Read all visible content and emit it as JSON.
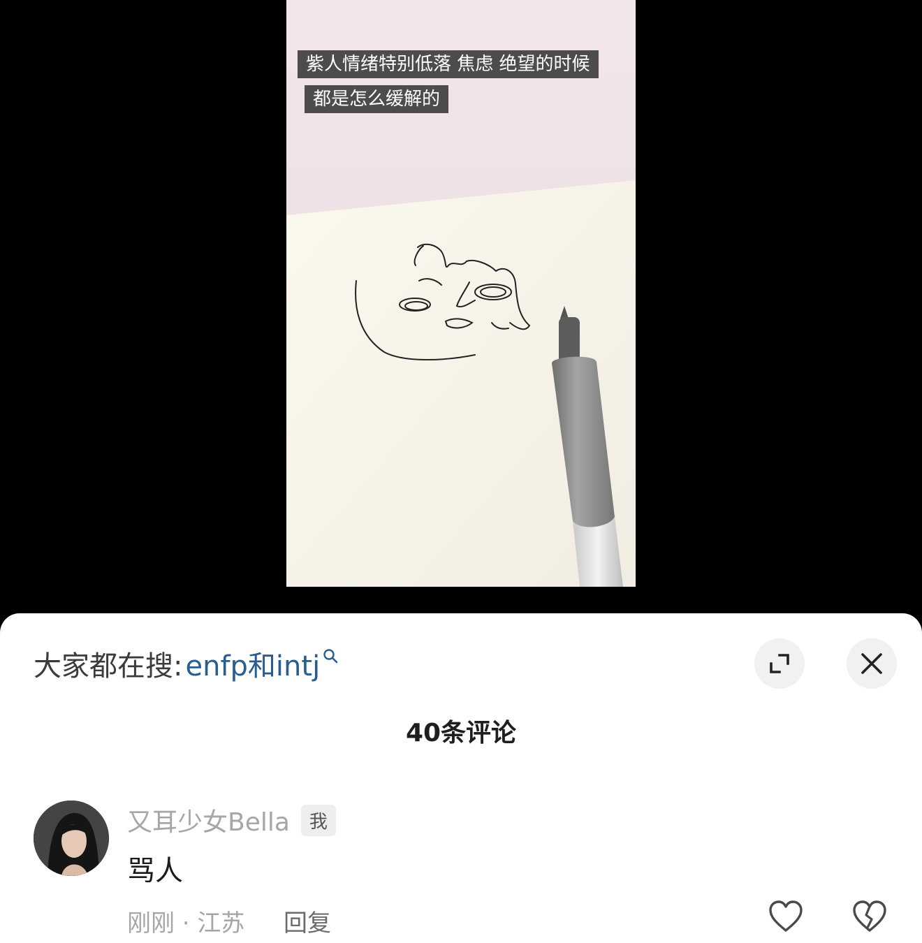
{
  "video": {
    "caption_line1": "紫人情绪特别低落 焦虑 绝望的时候",
    "caption_line2": "都是怎么缓解的"
  },
  "hot_search": {
    "prefix": "大家都在搜:",
    "keyword": "enfp和intj",
    "icon": "search-icon"
  },
  "header": {
    "comment_count": "40条评论",
    "expand_icon": "expand-icon",
    "close_icon": "close-icon"
  },
  "comment": {
    "username": "又耳少女Bella",
    "badge": "我",
    "text": "骂人",
    "time_location": "刚刚 · 江苏",
    "reply_label": "回复",
    "like_icon": "heart-icon",
    "dislike_icon": "broken-heart-icon"
  },
  "colors": {
    "keyword": "#2a5d8f",
    "meta_gray": "#a6a6a6",
    "background_dark": "#000000"
  }
}
